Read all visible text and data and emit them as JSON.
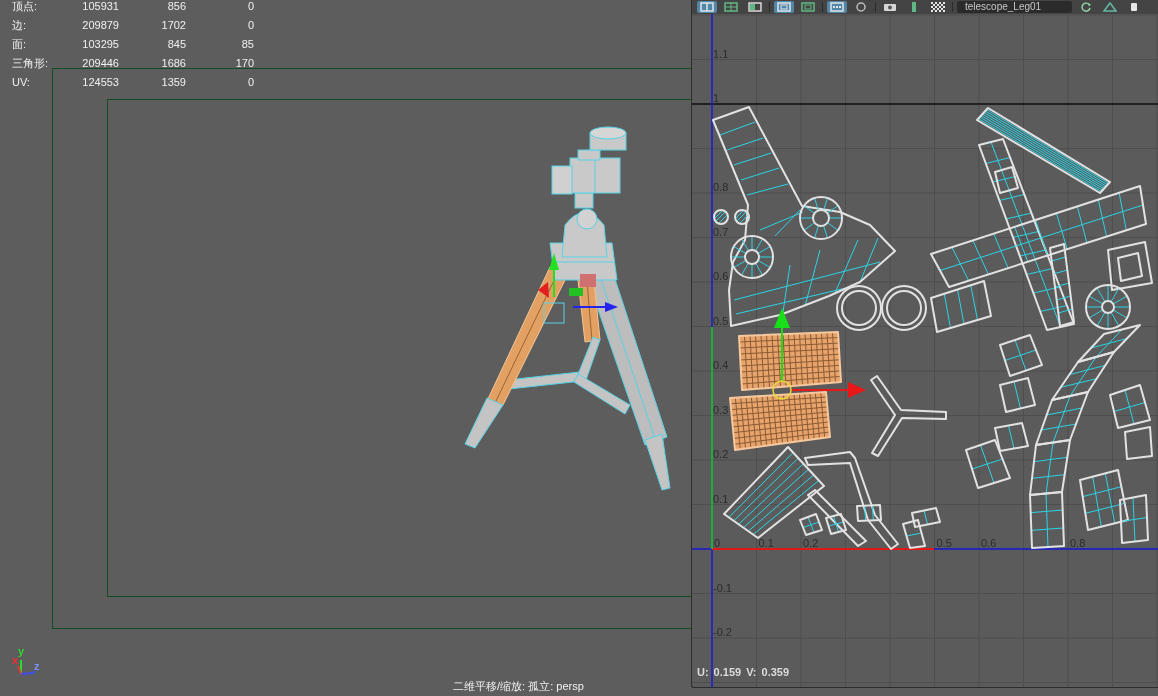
{
  "viewport": {
    "stats": [
      {
        "label": "顶点:",
        "values": [
          "105931",
          "856",
          "0"
        ]
      },
      {
        "label": "边:",
        "values": [
          "209879",
          "1702",
          "0"
        ]
      },
      {
        "label": "面:",
        "values": [
          "103295",
          "845",
          "85"
        ]
      },
      {
        "label": "三角形:",
        "values": [
          "209446",
          "1686",
          "170"
        ]
      },
      {
        "label": "UV:",
        "values": [
          "124553",
          "1359",
          "0"
        ]
      }
    ],
    "axis_labels": [
      {
        "label": "x",
        "color": "#f03030"
      },
      {
        "label": "y",
        "color": "#2ed82e"
      },
      {
        "label": "z",
        "color": "#7b93ff"
      }
    ],
    "status_text": "二维平移/缩放: 孤立: persp"
  },
  "uv_editor": {
    "toolbar": [
      {
        "items": [
          {
            "kind": "toggle",
            "on": true
          },
          {
            "kind": "toggle",
            "on": false
          },
          {
            "kind": "toggle",
            "on": false
          }
        ]
      },
      {
        "items": [
          {
            "kind": "toggle",
            "on": true
          },
          {
            "kind": "toggle",
            "on": false
          }
        ]
      },
      {
        "items": [
          {
            "kind": "toggle",
            "on": true
          },
          {
            "kind": "toggle",
            "on": false
          }
        ]
      },
      {
        "items": [
          {
            "kind": "toggle",
            "on": false
          },
          {
            "kind": "toggle",
            "on": false
          },
          {
            "kind": "toggle",
            "on": false
          }
        ]
      },
      {
        "items": [
          {
            "kind": "field",
            "value": "telescope_Leg01"
          },
          {
            "kind": "toggle",
            "on": false
          },
          {
            "kind": "toggle",
            "on": false
          },
          {
            "kind": "toggle",
            "on": false
          }
        ]
      }
    ],
    "u_ticks": [
      "0",
      "0.1",
      "0.2",
      "0.5",
      "0.6",
      "0.8"
    ],
    "v_ticks": [
      "1.1",
      "1",
      "0.8",
      "0.7",
      "0.6",
      "0.5",
      "0.4",
      "0.3",
      "0.2",
      "0.1",
      "-0.1",
      "-0.2"
    ],
    "shells": [
      {
        "selected": false
      },
      {
        "selected": false
      },
      {
        "selected": false
      },
      {
        "selected": false
      },
      {
        "selected": false
      },
      {
        "selected": false
      },
      {
        "selected": false
      },
      {
        "selected": true
      },
      {
        "selected": true
      },
      {
        "selected": false
      },
      {
        "selected": false
      },
      {
        "selected": false
      },
      {
        "selected": false
      },
      {
        "selected": false
      },
      {
        "selected": false
      },
      {
        "selected": false
      },
      {
        "selected": false
      },
      {
        "selected": false
      },
      {
        "selected": false
      },
      {
        "selected": false
      },
      {
        "selected": false
      },
      {
        "selected": false
      },
      {
        "selected": false
      },
      {
        "selected": false
      },
      {
        "selected": false
      },
      {
        "selected": false
      },
      {
        "selected": false
      },
      {
        "selected": false
      },
      {
        "selected": false
      },
      {
        "selected": false
      },
      {
        "selected": false
      },
      {
        "selected": false
      },
      {
        "selected": false
      },
      {
        "selected": false
      },
      {
        "selected": false
      },
      {
        "selected": false
      },
      {
        "selected": false
      },
      {
        "selected": false
      },
      {
        "selected": false
      }
    ],
    "readout": [
      {
        "label": "U:",
        "value": "0.159"
      },
      {
        "label": "V:",
        "value": "0.359"
      }
    ]
  }
}
